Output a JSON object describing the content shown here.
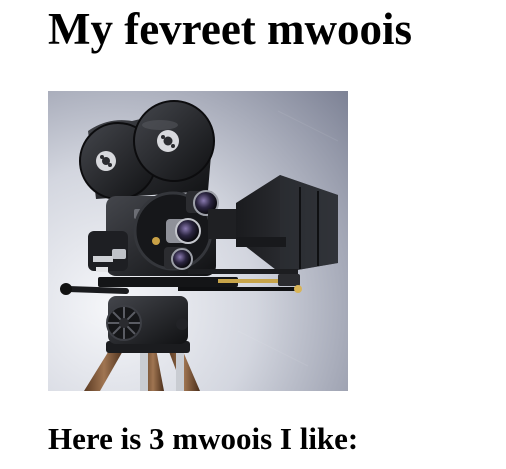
{
  "page": {
    "title": "My fevreet mwoois",
    "subheading": "Here is 3 mwoois I like:"
  },
  "image": {
    "subject": "vintage movie camera on tripod",
    "alt": "Vintage movie camera on tripod"
  },
  "colors": {
    "background": "#ffffff",
    "text": "#000000",
    "image_bg_light": "#f4f5f8",
    "image_bg_dark": "#7e8396",
    "camera_body": "#1c1d20"
  }
}
